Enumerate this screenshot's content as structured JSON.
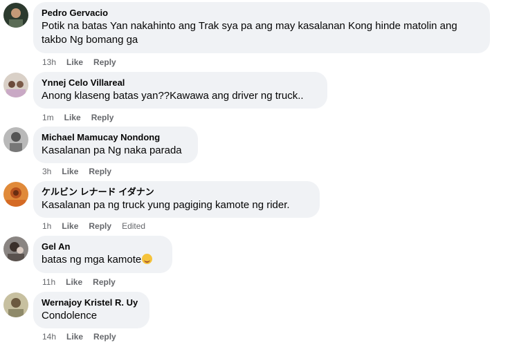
{
  "comments": [
    {
      "author": "Pedro Gervacio",
      "text": "Potik na batas Yan nakahinto ang Trak sya pa ang may kasalanan Kong hinde matolin ang takbo Ng bomang ga",
      "time": "13h",
      "like": "Like",
      "reply": "Reply",
      "avatar_color": "#2c3a2e"
    },
    {
      "author": "Ynnej Celo Villareal",
      "text": "Anong klaseng batas yan??Kawawa ang driver ng truck..",
      "time": "1m",
      "like": "Like",
      "reply": "Reply",
      "avatar_color": "#c9b6a8"
    },
    {
      "author": "Michael Mamucay Nondong",
      "text": "Kasalanan pa Ng naka parada",
      "time": "3h",
      "like": "Like",
      "reply": "Reply",
      "avatar_color": "#9a9a9a"
    },
    {
      "author": "ケルビン レナード イダナン",
      "text": "Kasalanan pa ng truck yung pagiging kamote ng rider.",
      "time": "1h",
      "like": "Like",
      "reply": "Reply",
      "edited": "Edited",
      "avatar_color": "#b8531f"
    },
    {
      "author": "Gel An",
      "text": "batas ng mga kamote",
      "time": "11h",
      "like": "Like",
      "reply": "Reply",
      "avatar_color": "#6f6a66"
    },
    {
      "author": "Wernajoy Kristel R. Uy",
      "text": "Condolence",
      "time": "14h",
      "like": "Like",
      "reply": "Reply",
      "avatar_color": "#a7a084"
    }
  ]
}
